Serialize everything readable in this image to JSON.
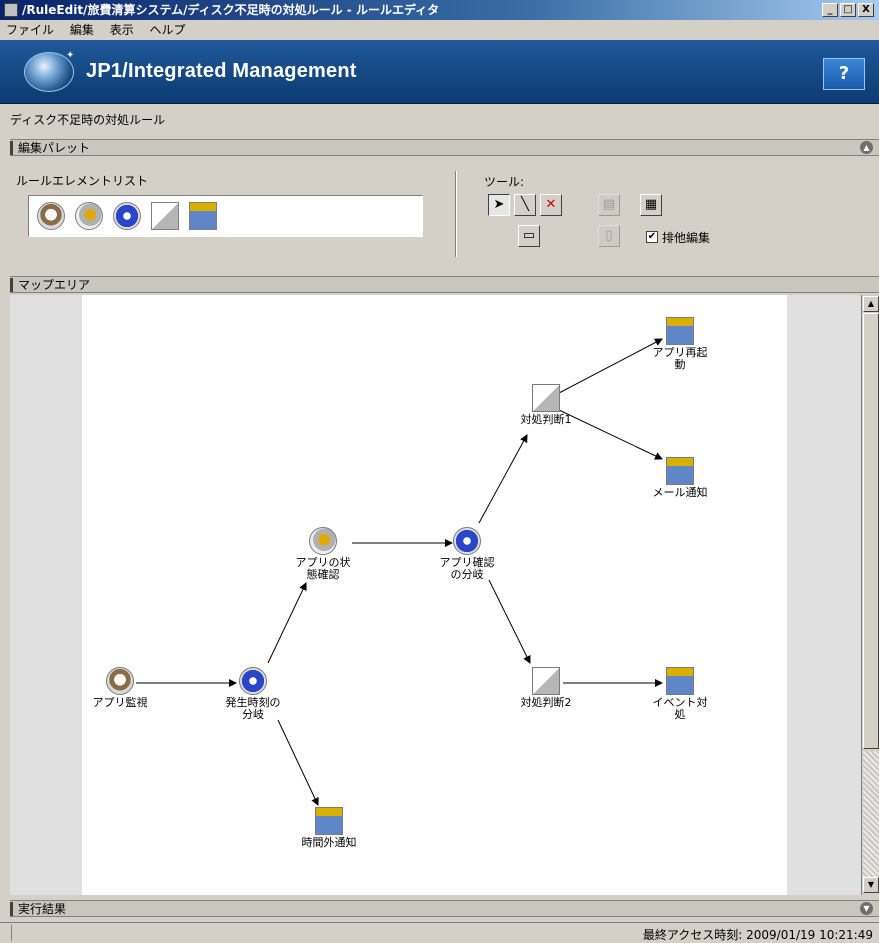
{
  "window": {
    "title": "/RuleEdit/旅費清算システム/ディスク不足時の対処ルール - ルールエディタ",
    "buttons": [
      "_",
      "□",
      "X"
    ]
  },
  "menu": [
    "ファイル",
    "編集",
    "表示",
    "ヘルプ"
  ],
  "banner": {
    "product": "JP1/Integrated Management",
    "help_label": "?"
  },
  "rule_name": "ディスク不足時の対処ルール",
  "palette": {
    "header": "編集パレット",
    "list_label": "ルールエレメントリスト",
    "elements": [
      "monitor-icon",
      "gear-icon",
      "branch-icon",
      "judge-icon",
      "action-icon"
    ],
    "tools_label": "ツール:",
    "exclusive_edit_label": "排他編集",
    "exclusive_edit_checked": true,
    "check_mark": "✔"
  },
  "map": {
    "header": "マップエリア",
    "nodes": [
      {
        "id": "app-monitor",
        "label": "アプリ監視"
      },
      {
        "id": "time-branch",
        "label": "発生時刻の分岐"
      },
      {
        "id": "app-state",
        "label": "アプリの状態確認"
      },
      {
        "id": "app-confirm-branch",
        "label": "アプリ確認の分岐"
      },
      {
        "id": "judge1",
        "label": "対処判断1"
      },
      {
        "id": "judge2",
        "label": "対処判断2"
      },
      {
        "id": "app-restart",
        "label": "アプリ再起動"
      },
      {
        "id": "mail-notify",
        "label": "メール通知"
      },
      {
        "id": "event-handle",
        "label": "イベント対処"
      },
      {
        "id": "offhours-notify",
        "label": "時間外通知"
      }
    ]
  },
  "results": {
    "header": "実行結果"
  },
  "status": {
    "last_access": "最終アクセス時刻: 2009/01/19 10:21:49"
  },
  "colors": {
    "banner": "#1f5a9a",
    "canvas": "#ffffff"
  }
}
